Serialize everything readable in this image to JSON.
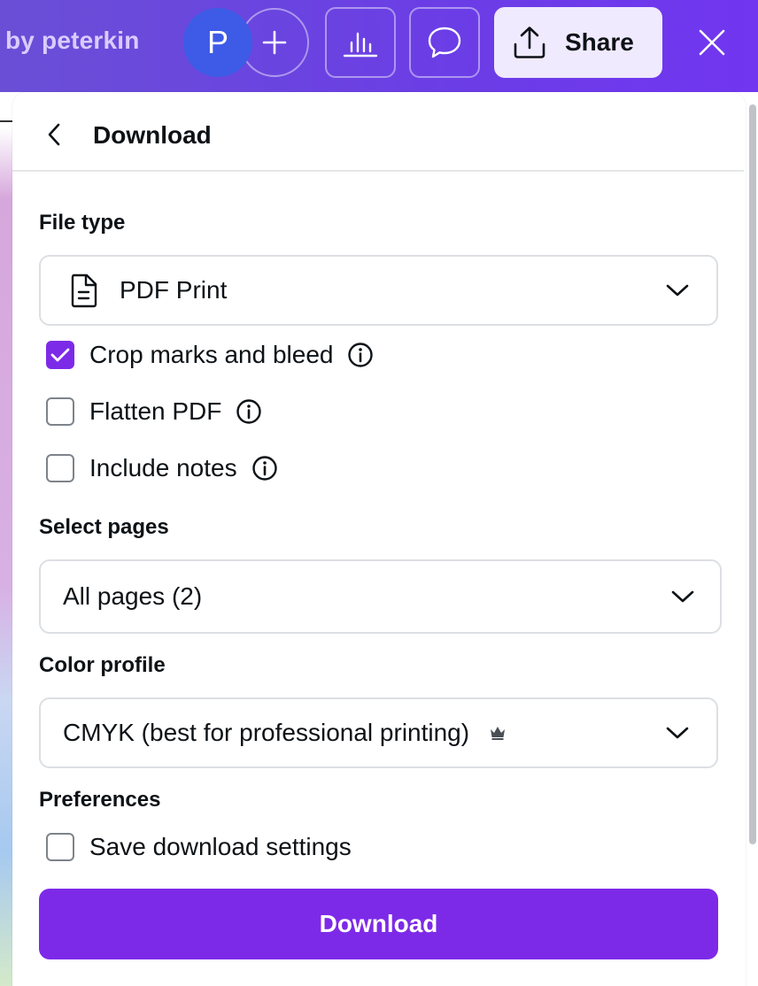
{
  "header": {
    "byline": "by peterkin",
    "avatar_letter": "P",
    "add_icon": "plus-icon",
    "analytics_icon": "bar-chart-icon",
    "comment_icon": "comment-icon",
    "share_label": "Share",
    "share_icon": "upload-icon",
    "close_icon": "close-icon"
  },
  "panel": {
    "title": "Download",
    "back_icon": "chevron-left-icon"
  },
  "file_type": {
    "label": "File type",
    "value": "PDF Print",
    "icon": "document-icon"
  },
  "options": [
    {
      "label": "Crop marks and bleed",
      "checked": true
    },
    {
      "label": "Flatten PDF",
      "checked": false
    },
    {
      "label": "Include notes",
      "checked": false
    }
  ],
  "select_pages": {
    "label": "Select pages",
    "value": "All pages (2)"
  },
  "color_profile": {
    "label": "Color profile",
    "value": "CMYK (best for professional printing)",
    "premium_icon": "crown-icon"
  },
  "preferences": {
    "label": "Preferences",
    "save_settings_label": "Save download settings",
    "save_settings_checked": false
  },
  "download_button": "Download",
  "colors": {
    "brand_purple": "#7d2ae8",
    "header_gradient_start": "#6a4fd6",
    "avatar_blue": "#3d5be6"
  }
}
